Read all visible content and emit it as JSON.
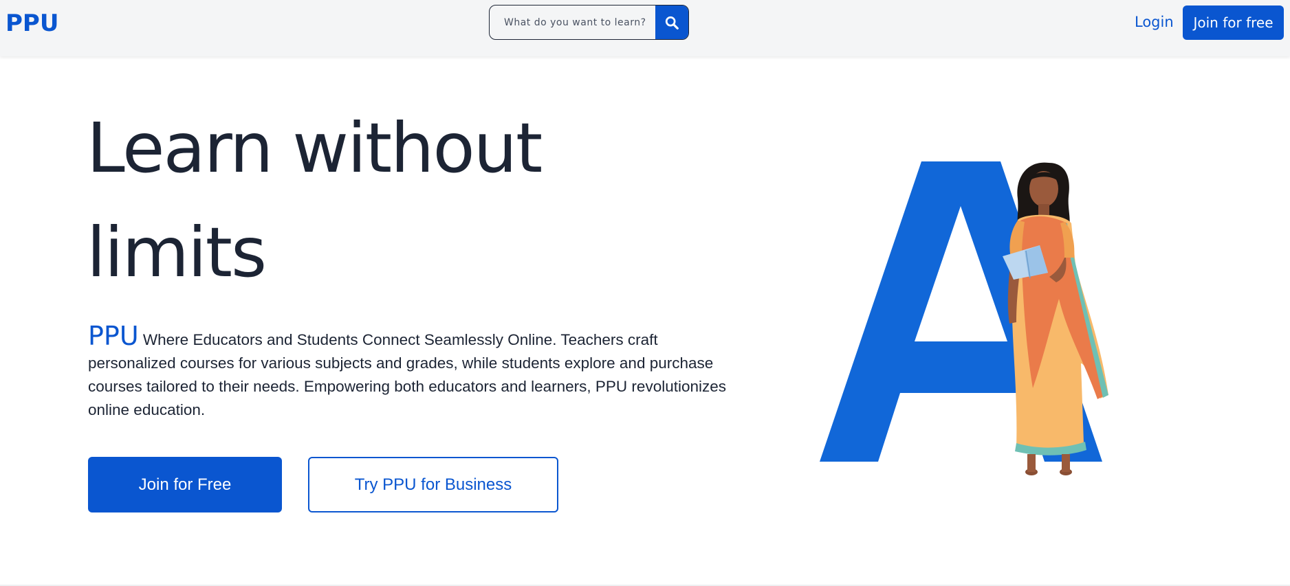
{
  "header": {
    "logo": "PPU",
    "search": {
      "placeholder": "What do you want to learn?",
      "button_icon": "search-icon"
    },
    "login_label": "Login",
    "join_label": "Join for free"
  },
  "hero": {
    "headline_line1": "Learn without",
    "headline_line2": "limits",
    "brand": "PPU",
    "description": "Where Educators and Students Connect Seamlessly Online. Teachers craft personalized courses for various subjects and grades, while students explore and purchase courses tailored to their needs. Empowering both educators and learners, PPU revolutionizes online education.",
    "primary_button": "Join for Free",
    "secondary_button": "Try PPU for Business"
  },
  "colors": {
    "accent": "#0a56d0",
    "text": "#1c2434",
    "header_bg": "#f4f5f6"
  }
}
